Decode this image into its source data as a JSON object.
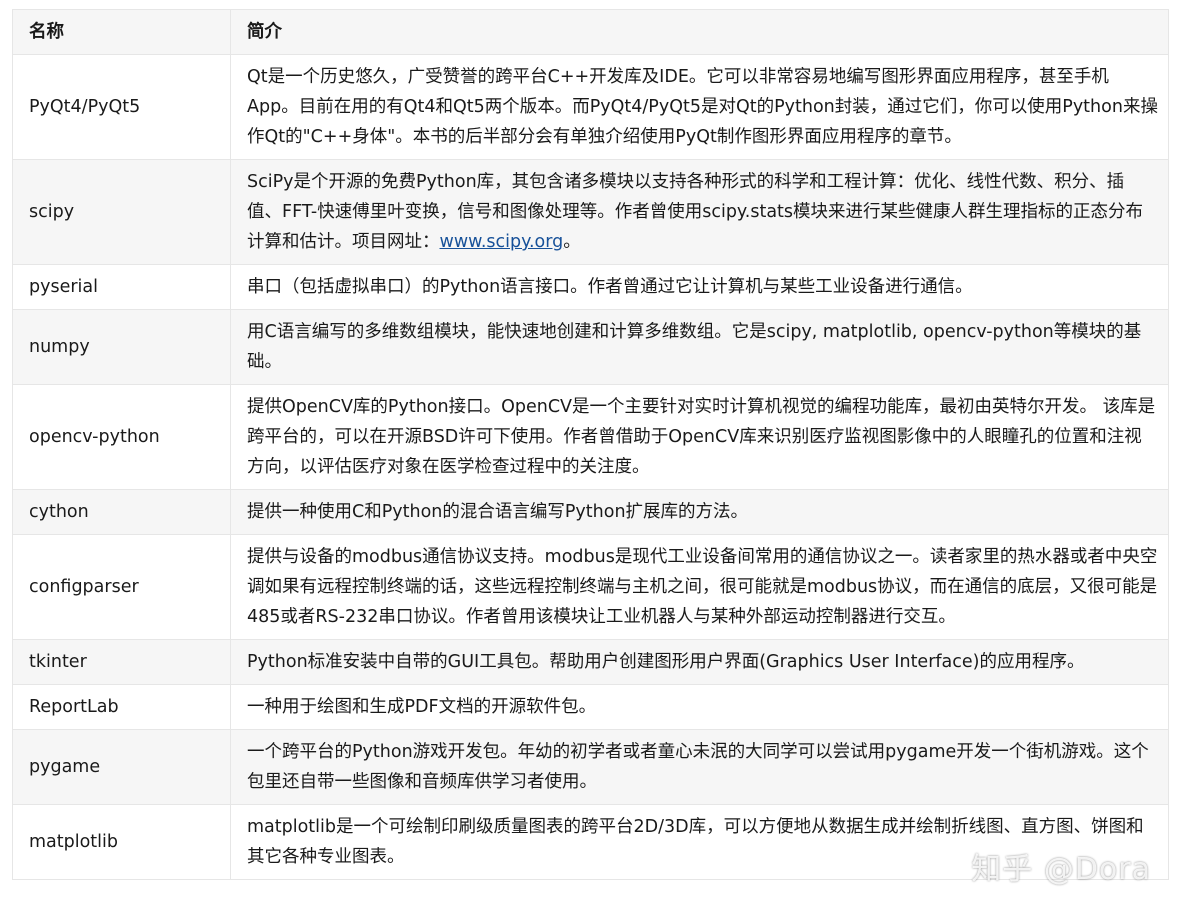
{
  "header": {
    "col1": "名称",
    "col2": "简介"
  },
  "rows": [
    {
      "name": "PyQt4/PyQt5",
      "desc": "Qt是一个历史悠久，广受赞誉的跨平台C++开发库及IDE。它可以非常容易地编写图形界面应用程序，甚至手机App。目前在用的有Qt4和Qt5两个版本。而PyQt4/PyQt5是对Qt的Python封装，通过它们，你可以使用Python来操作Qt的\"C++身体\"。本书的后半部分会有单独介绍使用PyQt制作图形界面应用程序的章节。"
    },
    {
      "name": "scipy",
      "desc": "SciPy是个开源的免费Python库，其包含诸多模块以支持各种形式的科学和工程计算：优化、线性代数、积分、插值、FFT-快速傅里叶变换，信号和图像处理等。作者曾使用scipy.stats模块来进行某些健康人群生理指标的正态分布计算和估计。项目网址：",
      "link": "www.scipy.org",
      "after": "。"
    },
    {
      "name": "pyserial",
      "desc": "串口（包括虚拟串口）的Python语言接口。作者曾通过它让计算机与某些工业设备进行通信。"
    },
    {
      "name": "numpy",
      "desc": "用C语言编写的多维数组模块，能快速地创建和计算多维数组。它是scipy, matplotlib, opencv-python等模块的基础。"
    },
    {
      "name": "opencv-python",
      "desc": "提供OpenCV库的Python接口。OpenCV是一个主要针对实时计算机视觉的编程功能库，最初由英特尔开发。 该库是跨平台的，可以在开源BSD许可下使用。作者曾借助于OpenCV库来识别医疗监视图影像中的人眼瞳孔的位置和注视方向，以评估医疗对象在医学检查过程中的关注度。"
    },
    {
      "name": "cython",
      "desc": "提供一种使用C和Python的混合语言编写Python扩展库的方法。"
    },
    {
      "name": "configparser",
      "desc": "提供与设备的modbus通信协议支持。modbus是现代工业设备间常用的通信协议之一。读者家里的热水器或者中央空调如果有远程控制终端的话，这些远程控制终端与主机之间，很可能就是modbus协议，而在通信的底层，又很可能是485或者RS-232串口协议。作者曾用该模块让工业机器人与某种外部运动控制器进行交互。"
    },
    {
      "name": "tkinter",
      "desc": "Python标准安装中自带的GUI工具包。帮助用户创建图形用户界面(Graphics User Interface)的应用程序。"
    },
    {
      "name": "ReportLab",
      "desc": "一种用于绘图和生成PDF文档的开源软件包。"
    },
    {
      "name": "pygame",
      "desc": "一个跨平台的Python游戏开发包。年幼的初学者或者童心未泯的大同学可以尝试用pygame开发一个街机游戏。这个包里还自带一些图像和音频库供学习者使用。"
    },
    {
      "name": "matplotlib",
      "desc": "matplotlib是一个可绘制印刷级质量图表的跨平台2D/3D库，可以方便地从数据生成并绘制折线图、直方图、饼图和其它各种专业图表。"
    }
  ],
  "watermark": "知乎 @Dora"
}
